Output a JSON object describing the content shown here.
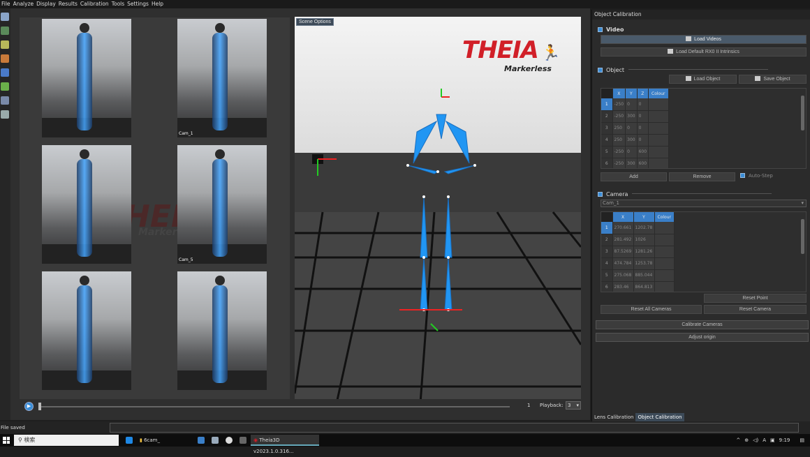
{
  "menu": [
    "File",
    "Analyze",
    "Display",
    "Results",
    "Calibration",
    "Tools",
    "Settings",
    "Help"
  ],
  "viewer": {
    "scene_options": "Scene Options",
    "logo_text": "THEIA",
    "logo_sub": "Markerless",
    "bg_watermark": "THEIA",
    "bg_watermark_sub": "Markerl",
    "cams": [
      {
        "label": ""
      },
      {
        "label": "Cam_1"
      },
      {
        "label": ""
      },
      {
        "label": "Cam_5"
      },
      {
        "label": ""
      },
      {
        "label": ""
      }
    ]
  },
  "playback": {
    "frame": "1",
    "label": "Playback:",
    "speed": "3"
  },
  "panel": {
    "title": "Object Calibration",
    "video": {
      "section": "Video",
      "load_videos": "Load Videos",
      "load_intrinsics": "Load Default RX0 II Intrinsics"
    },
    "object": {
      "section": "Object",
      "load_object": "Load Object",
      "save_object": "Save Object",
      "columns": [
        "X",
        "Y",
        "Z",
        "Colour"
      ],
      "rows": [
        {
          "idx": "1",
          "cells": [
            "-250",
            "0",
            "0"
          ]
        },
        {
          "idx": "2",
          "cells": [
            "-250",
            "300",
            "0"
          ]
        },
        {
          "idx": "3",
          "cells": [
            "250",
            "0",
            "0"
          ]
        },
        {
          "idx": "4",
          "cells": [
            "250",
            "300",
            "0"
          ]
        },
        {
          "idx": "5",
          "cells": [
            "-250",
            "0",
            "600"
          ]
        },
        {
          "idx": "6",
          "cells": [
            "-250",
            "300",
            "600"
          ]
        }
      ],
      "add": "Add",
      "remove": "Remove",
      "auto_step": "Auto-Step"
    },
    "camera": {
      "section": "Camera",
      "selected": "Cam_1",
      "columns": [
        "X",
        "Y",
        "Colour"
      ],
      "rows": [
        {
          "idx": "1",
          "cells": [
            "270.661",
            "1202.78"
          ]
        },
        {
          "idx": "2",
          "cells": [
            "281.492",
            "1026"
          ]
        },
        {
          "idx": "3",
          "cells": [
            "87.5269",
            "1281.26"
          ]
        },
        {
          "idx": "4",
          "cells": [
            "474.784",
            "1253.78"
          ]
        },
        {
          "idx": "5",
          "cells": [
            "275.068",
            "885.044"
          ]
        },
        {
          "idx": "6",
          "cells": [
            "283.46",
            "864.813"
          ]
        }
      ],
      "reset_point": "Reset Point",
      "reset_all": "Reset All Cameras",
      "reset_camera": "Reset Camera"
    },
    "calibrate": "Calibrate Cameras",
    "adjust_origin": "Adjust origin",
    "tabs": [
      "Lens Calibration",
      "Object Calibration"
    ]
  },
  "status": {
    "text": "File saved"
  },
  "taskbar": {
    "search": "検索",
    "folder": "6cam_",
    "app": "Theia3D v2023.1.0.316...",
    "clock": "9:19",
    "ime": "A"
  },
  "colors": {
    "accent": "#3a7fc8",
    "logo_red": "#d11f28",
    "skeleton_blue": "#2196f3"
  }
}
